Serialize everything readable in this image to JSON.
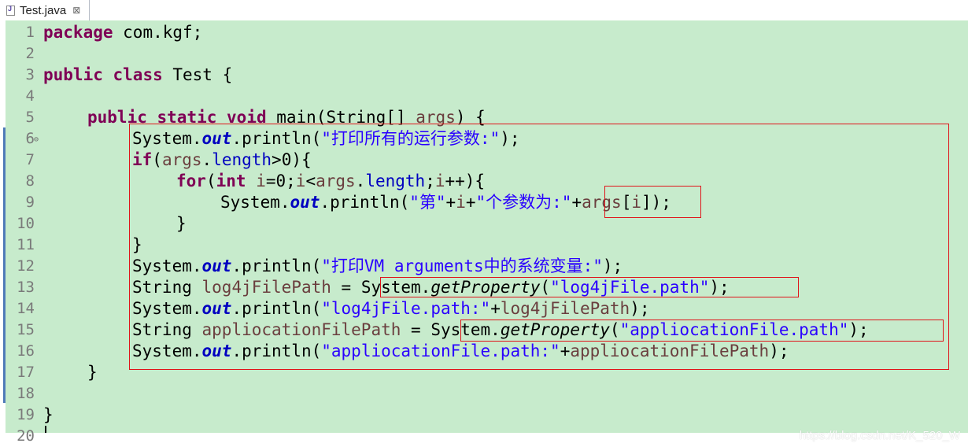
{
  "tab": {
    "label": "Test.java",
    "close_glyph": "⊠",
    "icon": "java-file-icon"
  },
  "line_numbers": [
    "1",
    "2",
    "3",
    "4",
    "5",
    "6",
    "7",
    "8",
    "9",
    "10",
    "11",
    "12",
    "13",
    "14",
    "15",
    "16",
    "17",
    "18",
    "19",
    "20"
  ],
  "code": {
    "l1": {
      "kw": "package",
      "rest": " com.kgf;"
    },
    "l3": {
      "kw1": "public",
      "kw2": "class",
      "rest": " Test {"
    },
    "l5": {
      "kw1": "public",
      "kw2": "static",
      "kw3": "void",
      "pre": " main(String[] ",
      "args": "args",
      "post": ") {"
    },
    "l6": {
      "a": "System.",
      "out": "out",
      "b": ".println(",
      "s": "\"打印所有的运行参数:\"",
      "c": ");"
    },
    "l7": {
      "kw": "if",
      "a": "(",
      "args": "args",
      "b": ".",
      "len": "length",
      "c": ">0){"
    },
    "l8": {
      "kw1": "for",
      "a": "(",
      "kw2": "int",
      "b": " ",
      "i1": "i",
      "c": "=0;",
      "i2": "i",
      "d": "<",
      "args": "args",
      "e": ".",
      "len": "length",
      "f": ";",
      "i3": "i",
      "g": "++){"
    },
    "l9": {
      "a": "System.",
      "out": "out",
      "b": ".println(",
      "s1": "\"第\"",
      "c": "+",
      "i": "i",
      "d": "+",
      "s2": "\"个参数为:\"",
      "e": "+",
      "args": "args",
      "f": "[",
      "i2": "i",
      "g": "]);"
    },
    "l10": {
      "a": "}"
    },
    "l11": {
      "a": "}"
    },
    "l12": {
      "a": "System.",
      "out": "out",
      "b": ".println(",
      "s": "\"打印VM arguments中的系统变量:\"",
      "c": ");"
    },
    "l13": {
      "a": "String ",
      "v": "log4jFilePath",
      "b": " = System.",
      "m": "getProperty",
      "c": "(",
      "s": "\"log4jFile.path\"",
      "d": ");"
    },
    "l14": {
      "a": "System.",
      "out": "out",
      "b": ".println(",
      "s": "\"log4jFile.path:\"",
      "c": "+",
      "v": "log4jFilePath",
      "d": ");"
    },
    "l15": {
      "a": "String ",
      "v": "appliocationFilePath",
      "b": " = System.",
      "m": "getProperty",
      "c": "(",
      "s": "\"appliocationFile.path\"",
      "d": ");"
    },
    "l16": {
      "a": "System.",
      "out": "out",
      "b": ".println(",
      "s": "\"appliocationFile.path:\"",
      "c": "+",
      "v": "appliocationFilePath",
      "d": ");"
    },
    "l17": {
      "a": "}"
    },
    "l19": {
      "a": "}"
    }
  },
  "watermark": "https://blog.csdn.net/K_520_W",
  "colors": {
    "editor_bg": "#c7ebcc",
    "highlight_box": "#e0141a",
    "keyword": "#7f0055",
    "string": "#2a00ff",
    "field": "#0000c0"
  }
}
